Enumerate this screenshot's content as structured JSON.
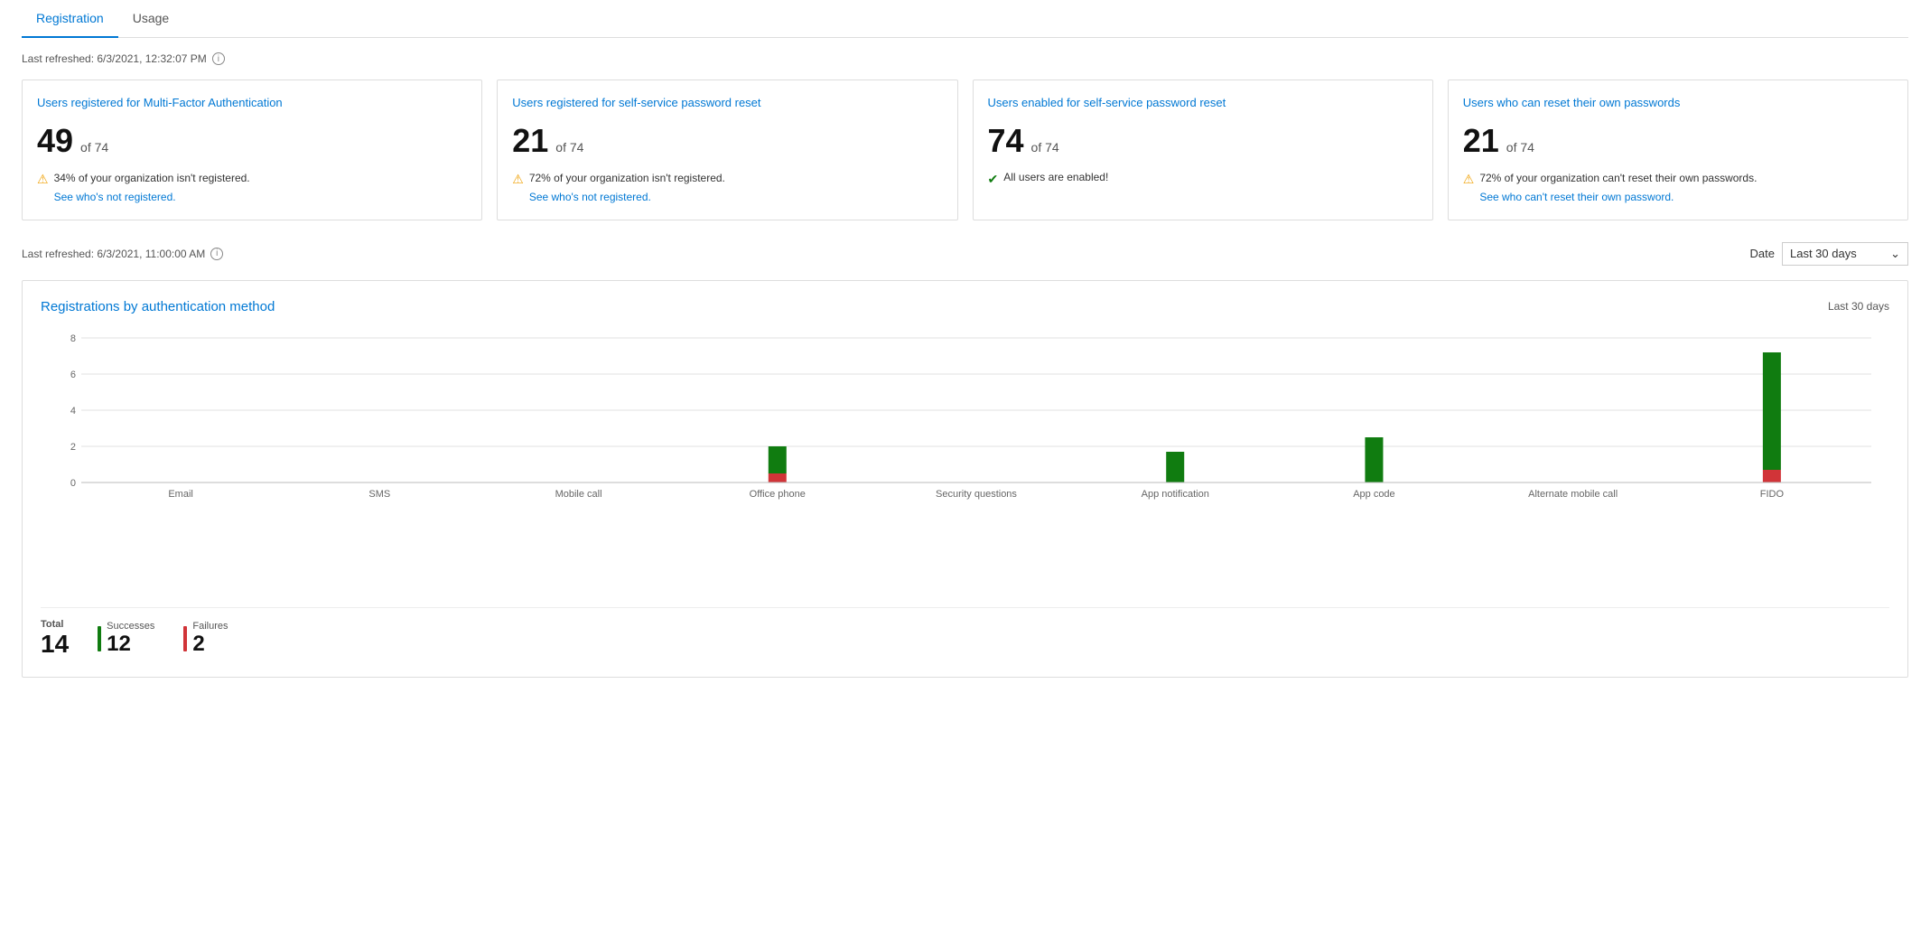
{
  "tabs": [
    {
      "id": "registration",
      "label": "Registration",
      "active": true
    },
    {
      "id": "usage",
      "label": "Usage",
      "active": false
    }
  ],
  "top_refresh": {
    "label": "Last refreshed: 6/3/2021, 12:32:07 PM"
  },
  "cards": [
    {
      "id": "mfa-card",
      "title": "Users registered for Multi-Factor Authentication",
      "count": "49",
      "total": "of 74",
      "warning_type": "warn",
      "warning_text": "34% of your organization isn't registered.",
      "link_text": "See who's not registered."
    },
    {
      "id": "sspr-card",
      "title": "Users registered for self-service password reset",
      "count": "21",
      "total": "of 74",
      "warning_type": "warn",
      "warning_text": "72% of your organization isn't registered.",
      "link_text": "See who's not registered."
    },
    {
      "id": "enabled-card",
      "title": "Users enabled for self-service password reset",
      "count": "74",
      "total": "of 74",
      "warning_type": "success",
      "warning_text": "All users are enabled!",
      "link_text": ""
    },
    {
      "id": "reset-card",
      "title": "Users who can reset their own passwords",
      "count": "21",
      "total": "of 74",
      "warning_type": "warn",
      "warning_text": "72% of your organization can't reset their own passwords.",
      "link_text": "See who can't reset their own password."
    }
  ],
  "second_refresh": {
    "label": "Last refreshed: 6/3/2021, 11:00:00 AM"
  },
  "date_filter": {
    "label": "Date",
    "value": "Last 30 days"
  },
  "chart": {
    "title": "Registrations by authentication method",
    "period": "Last 30 days",
    "y_labels": [
      "0",
      "2",
      "4",
      "6",
      "8"
    ],
    "y_max": 8,
    "bars": [
      {
        "label": "Email",
        "success": 0,
        "failure": 0
      },
      {
        "label": "SMS",
        "success": 0,
        "failure": 0
      },
      {
        "label": "Mobile call",
        "success": 0,
        "failure": 0
      },
      {
        "label": "Office phone",
        "success": 1.5,
        "failure": 0.5
      },
      {
        "label": "Security questions",
        "success": 0,
        "failure": 0
      },
      {
        "label": "App notification",
        "success": 1.7,
        "failure": 0
      },
      {
        "label": "App code",
        "success": 2.5,
        "failure": 0
      },
      {
        "label": "Alternate mobile call",
        "success": 0,
        "failure": 0
      },
      {
        "label": "FIDO",
        "success": 6.5,
        "failure": 0.7
      }
    ],
    "footer": {
      "total_label": "Total",
      "total_value": "14",
      "success_label": "Successes",
      "success_value": "12",
      "failure_label": "Failures",
      "failure_value": "2"
    }
  }
}
